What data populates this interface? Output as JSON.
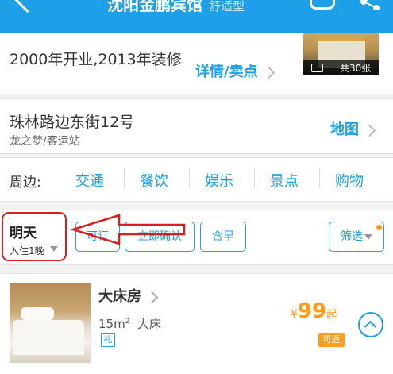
{
  "header": {
    "title": "沈阳金鹏宾馆",
    "subtitle": "舒适型"
  },
  "hotel": {
    "opened": "2000年开业,2013年装修",
    "details_link": "详情/卖点",
    "photo_count": "共30张",
    "address": "珠林路边东街12号",
    "nearby_place": "龙之梦/客运站",
    "map_link": "地图"
  },
  "surroundings": {
    "label": "周边:",
    "items": [
      "交通",
      "餐饮",
      "娱乐",
      "景点",
      "购物"
    ]
  },
  "filters": {
    "date_main": "明天",
    "date_sub": "入住1晚",
    "bookable": "可订",
    "instant_confirm": "立即确认",
    "breakfast": "含早",
    "filter": "筛选"
  },
  "room": {
    "name": "大床房",
    "size": "15m",
    "size_unit_sup": "2",
    "bed": "大床",
    "gift_badge": "礼",
    "currency": "¥",
    "price": "99",
    "price_suffix": "起",
    "refund_badge": "可返"
  },
  "colors": {
    "accent": "#1da0e8",
    "price": "#ff9c1a",
    "annotation": "#d81e1e"
  }
}
